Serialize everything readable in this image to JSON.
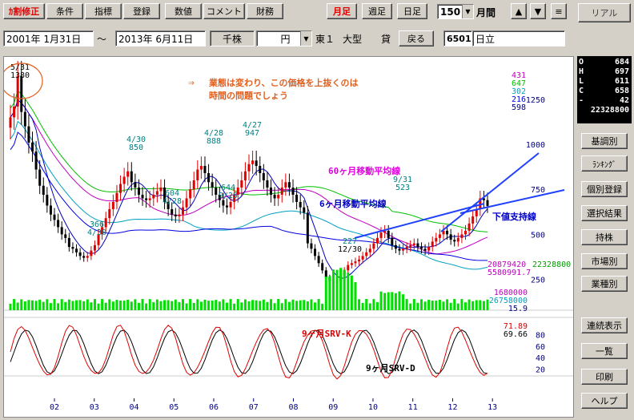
{
  "toolbar": {
    "items": [
      "ｶ割修正",
      "条件",
      "指標",
      "登録",
      "数値",
      "コメント",
      "財務"
    ],
    "period_monthly": "月足",
    "period_weekly": "週足",
    "period_daily": "日足",
    "count_value": "150",
    "count_unit": "月間",
    "up_arrow": "▲",
    "down_arrow": "▼",
    "menu_icon": "≡",
    "real_button": "リアル"
  },
  "infobar": {
    "date_from": "2001年 1月31日",
    "tilde": "～",
    "date_to": "2013年 6月11日",
    "unit_label": "千株",
    "currency": "円",
    "exchange": "東１",
    "size": "大型",
    "lending": "貸",
    "back_button": "戻る",
    "code": "6501",
    "name": "日立"
  },
  "quote": {
    "rows": [
      {
        "k": "O",
        "v": "684"
      },
      {
        "k": "H",
        "v": "697"
      },
      {
        "k": "L",
        "v": "611"
      },
      {
        "k": "C",
        "v": "658"
      },
      {
        "k": "-",
        "v": "42"
      },
      {
        "k": "",
        "v": "22328800"
      }
    ]
  },
  "side_menu": [
    "基調別",
    "ﾗﾝｷﾝｸﾞ",
    "個別登録",
    "選択結果",
    "持株",
    "市場別",
    "業種別",
    "連続表示",
    "一覧",
    "印刷",
    "ヘルプ"
  ],
  "chart_data": {
    "type": "candlestick",
    "price_axis_ticks": [
      "1250",
      "1000",
      "750",
      "500",
      "250"
    ],
    "x_tick_labels": [
      "02",
      "03",
      "04",
      "05",
      "06",
      "07",
      "08",
      "09",
      "10",
      "11",
      "12",
      "13"
    ],
    "indicator_axis_ticks": [
      "80",
      "60",
      "40",
      "20"
    ],
    "ma_values": [
      "431",
      "647",
      "302",
      "216",
      "598"
    ],
    "ma_colors": [
      "#c000c0",
      "#00c000",
      "#00a0c0",
      "#0000e0",
      "#000080"
    ],
    "volume_values": [
      "20879420",
      "22328800",
      "5580991.7",
      "1680000",
      "26758000",
      "15.9"
    ],
    "srv_values": [
      "71.89",
      "69.66"
    ],
    "annotations": [
      {
        "text": "5/31",
        "sub": "1380"
      },
      {
        "text": "4/30",
        "sub": "850"
      },
      {
        "text": "604",
        "sub": "4/28"
      },
      {
        "text": "4/28",
        "sub": "888"
      },
      {
        "text": "644",
        "sub": "9/29"
      },
      {
        "text": "4/27",
        "sub": "947"
      },
      {
        "text": "366",
        "sub": "4/30"
      },
      {
        "text": "227",
        "sub": "12/30"
      },
      {
        "text": "9/31",
        "sub": "523"
      }
    ],
    "comment_line1": "業態は変わり、この価格を上抜くのは",
    "comment_line2": "時間の問題でしょう",
    "arrow": "⇒",
    "ma60_label": "60ヶ月移動平均線",
    "ma6_label": "6ヶ月移動平均線",
    "support_label": "下値支持線",
    "srvk_label": "9ヶ月SRV-K",
    "srvd_label": "9ヶ月SRV-D",
    "monthly_closes": [
      1150,
      1210,
      1380,
      1180,
      1100,
      1010,
      960,
      860,
      770,
      720,
      660,
      610,
      580,
      540,
      500,
      480,
      430,
      420,
      400,
      380,
      370,
      380,
      410,
      440,
      500,
      540,
      590,
      640,
      680,
      730,
      780,
      820,
      850,
      790,
      760,
      720,
      700,
      690,
      700,
      720,
      740,
      760,
      680,
      640,
      610,
      600,
      610,
      650,
      700,
      750,
      800,
      860,
      880,
      840,
      790,
      760,
      720,
      690,
      660,
      650,
      680,
      720,
      760,
      800,
      850,
      890,
      910,
      880,
      840,
      800,
      760,
      720,
      700,
      720,
      760,
      790,
      760,
      720,
      680,
      650,
      620,
      450,
      420,
      380,
      340,
      300,
      260,
      240,
      230,
      240,
      270,
      300,
      330,
      340,
      350,
      360,
      380,
      400,
      420,
      450,
      480,
      510,
      520,
      480,
      440,
      420,
      410,
      420,
      430,
      440,
      450,
      430,
      420,
      410,
      430,
      460,
      480,
      500,
      520,
      500,
      470,
      460,
      480,
      500,
      520,
      560,
      600,
      640,
      700,
      690,
      658
    ]
  }
}
